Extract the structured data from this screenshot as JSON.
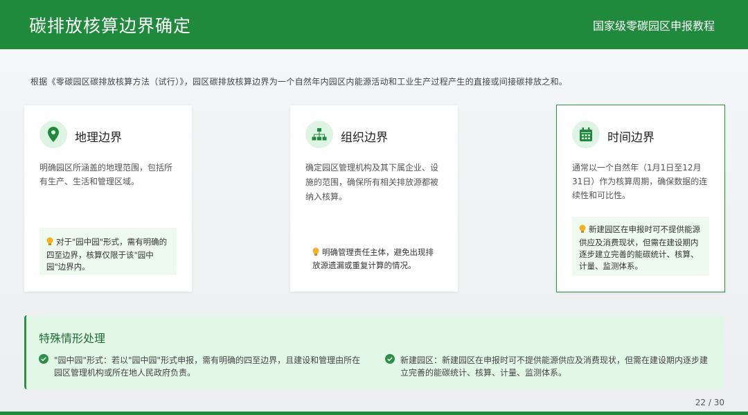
{
  "header": {
    "title": "碳排放核算边界确定",
    "subtitle": "国家级零碳园区申报教程"
  },
  "intro": "根据《零碳园区碳排放核算方法（试行）》，园区碳排放核算边界为一个自然年内园区内能源活动和工业生产过程产生的直接或间接碳排放之和。",
  "cards": [
    {
      "icon": "location-pin-icon",
      "title": "地理边界",
      "desc": "明确园区所涵盖的地理范围，包括所有生产、生活和管理区域。",
      "tip": "对于\"园中园\"形式，需有明确的四至边界，核算仅限于该\"园中园\"边界内。"
    },
    {
      "icon": "org-chart-icon",
      "title": "组织边界",
      "desc": "确定园区管理机构及其下属企业、设施的范围，确保所有相关排放源都被纳入核算。",
      "tip": "明确管理责任主体，避免出现排放源遗漏或重复计算的情况。"
    },
    {
      "icon": "calendar-icon",
      "title": "时间边界",
      "desc": "通常以一个自然年（1月1日至12月31日）作为核算周期，确保数据的连续性和可比性。",
      "tip": "新建园区在申报时可不提供能源供应及消费现状，但需在建设期内逐步建立完善的能碳统计、核算、计量、监测体系。"
    }
  ],
  "special": {
    "title": "特殊情形处理",
    "items": [
      "\"园中园\"形式：若以\"园中园\"形式申报，需有明确的四至边界，且建设和管理由所在园区管理机构或所在地人民政府负责。",
      "新建园区：新建园区在申报时可不提供能源供应及消费现状，但需在建设期内逐步建立完善的能碳统计、核算、计量、监测体系。"
    ]
  },
  "page": "22 / 30",
  "colors": {
    "brand_green": "#1f8a3b",
    "light_green": "#e3f7e6",
    "bulb": "#f2b01e"
  }
}
